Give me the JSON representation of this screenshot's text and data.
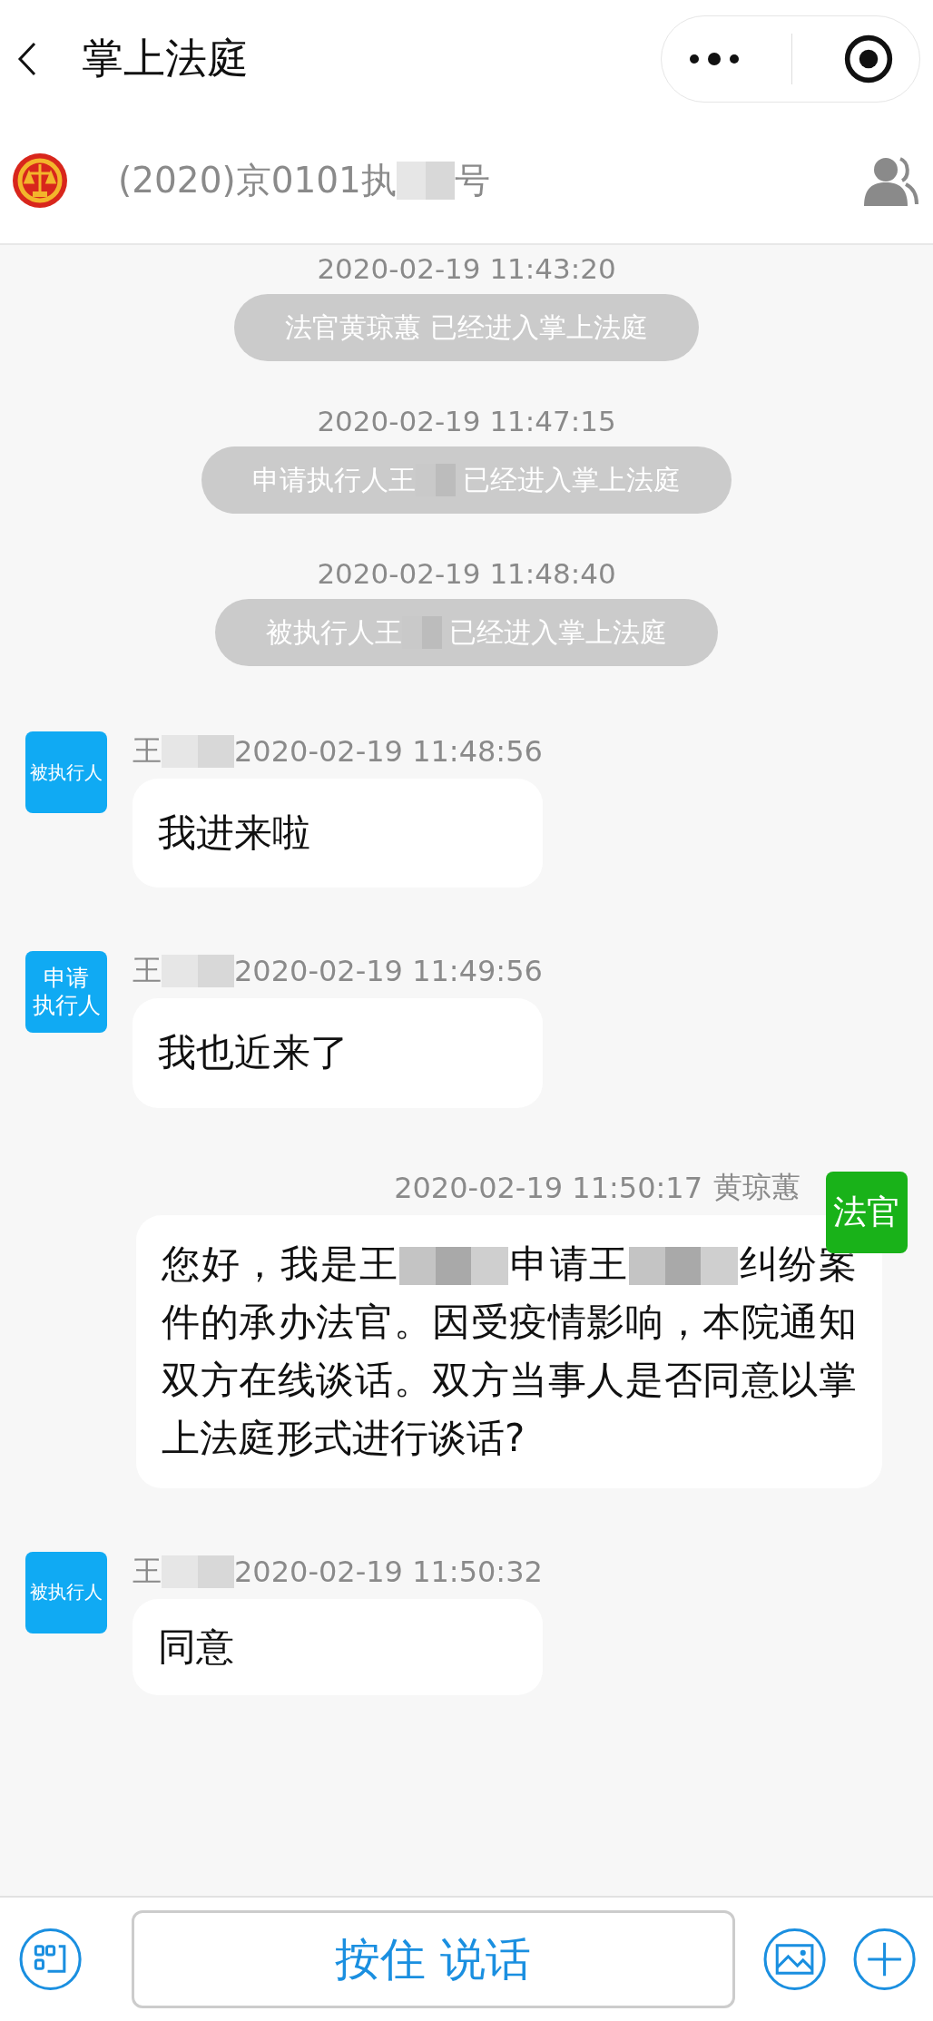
{
  "nav": {
    "title": "掌上法庭"
  },
  "case": {
    "parts": [
      {
        "kind": "text",
        "text": "(2020)京0101执"
      },
      {
        "kind": "redacted"
      },
      {
        "kind": "text",
        "text": "号"
      }
    ]
  },
  "messages": [
    {
      "kind": "notice",
      "time": "2020-02-19 11:43:20",
      "parts": [
        {
          "kind": "text",
          "text": "法官黄琼蕙 已经进入掌上法庭"
        }
      ]
    },
    {
      "kind": "notice",
      "time": "2020-02-19 11:47:15",
      "parts": [
        {
          "kind": "text",
          "text": "申请执行人王"
        },
        {
          "kind": "redacted"
        },
        {
          "kind": "text",
          "text": "已经进入掌上法庭"
        }
      ]
    },
    {
      "kind": "notice",
      "time": "2020-02-19 11:48:40",
      "parts": [
        {
          "kind": "text",
          "text": "被执行人王"
        },
        {
          "kind": "redacted"
        },
        {
          "kind": "text",
          "text": "已经进入掌上法庭"
        }
      ]
    },
    {
      "kind": "incoming",
      "avatar": [
        "被执行人"
      ],
      "color": "#10aaf3",
      "sender": [
        {
          "kind": "text",
          "text": "王"
        },
        {
          "kind": "redacted"
        }
      ],
      "time": "2020-02-19 11:48:56",
      "parts": [
        {
          "kind": "text",
          "text": "我进来啦"
        }
      ]
    },
    {
      "kind": "incoming",
      "avatar": [
        "申请",
        "执行人"
      ],
      "color": "#10aaf3",
      "sender": [
        {
          "kind": "text",
          "text": "王"
        },
        {
          "kind": "redacted"
        }
      ],
      "time": "2020-02-19 11:49:56",
      "parts": [
        {
          "kind": "text",
          "text": "我也近来了"
        }
      ]
    },
    {
      "kind": "outgoing",
      "avatar": [
        "法官"
      ],
      "color": "#19b219",
      "sender": [
        {
          "kind": "text",
          "text": "黄琼蕙"
        }
      ],
      "time": "2020-02-19 11:50:17",
      "parts": [
        {
          "kind": "text",
          "text": "您好，我是王"
        },
        {
          "kind": "redacted"
        },
        {
          "kind": "text",
          "text": "申请王"
        },
        {
          "kind": "redacted"
        },
        {
          "kind": "text",
          "text": "纠纷案件的承办法官。因受疫情影响，本院通知双方在线谈话。双方当事人是否同意以掌上法庭形式进行谈话?"
        }
      ]
    },
    {
      "kind": "incoming",
      "avatar": [
        "被执行人"
      ],
      "color": "#10aaf3",
      "sender": [
        {
          "kind": "text",
          "text": "王"
        },
        {
          "kind": "redacted"
        }
      ],
      "time": "2020-02-19 11:50:32",
      "parts": [
        {
          "kind": "text",
          "text": "同意"
        }
      ]
    }
  ],
  "input": {
    "label": "按住 说话"
  }
}
